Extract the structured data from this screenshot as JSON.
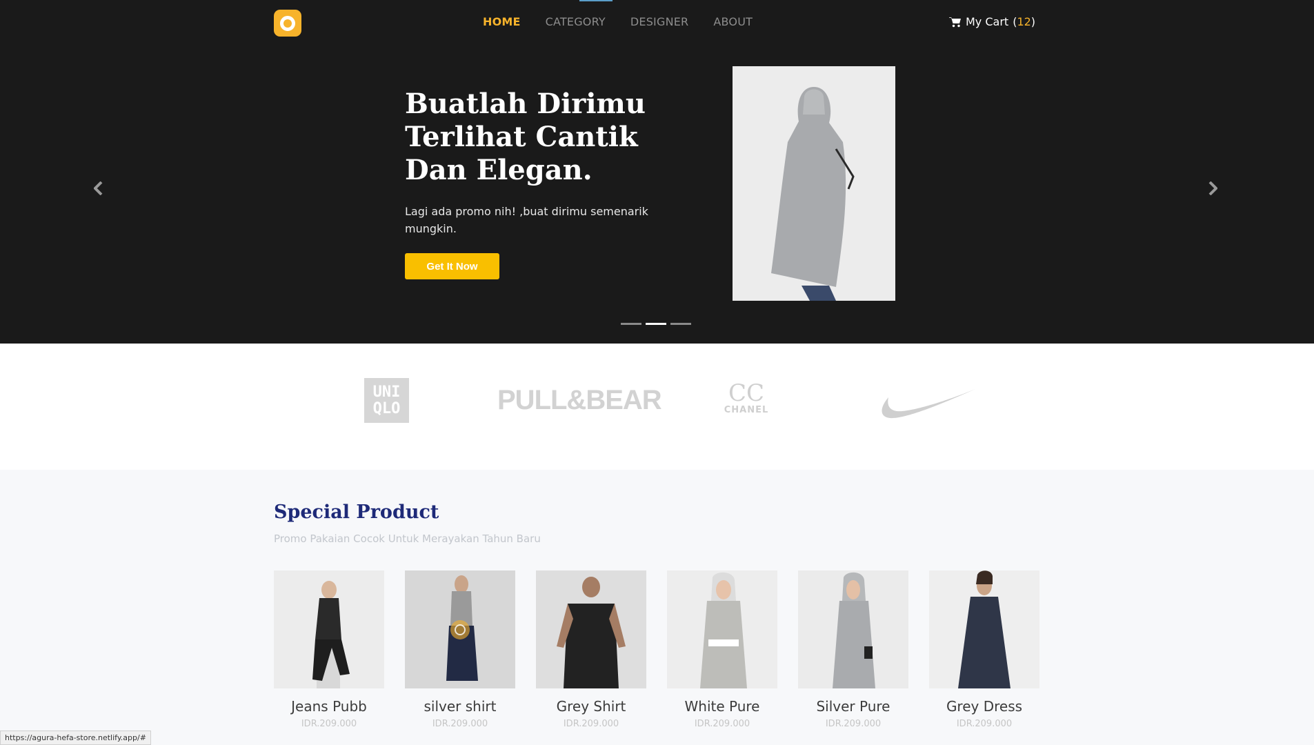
{
  "header": {
    "logo": "store-logo",
    "nav": [
      {
        "label": "HOME",
        "active": true
      },
      {
        "label": "CATEGORY",
        "active": false
      },
      {
        "label": "DESIGNER",
        "active": false
      },
      {
        "label": "ABOUT",
        "active": false
      }
    ],
    "cart": {
      "label": "My Cart",
      "open_paren": "(",
      "count": "12",
      "close_paren": ")",
      "icon": "cart-icon"
    }
  },
  "hero": {
    "title": "Buatlah Dirimu Terlihat Cantik Dan Elegan.",
    "subtitle": "Lagi ada promo nih! ,buat dirimu semenarik mungkin.",
    "cta": "Get It Now",
    "slides": 3,
    "active_slide": 2,
    "prev_icon": "chevron-left-icon",
    "next_icon": "chevron-right-icon"
  },
  "brands": {
    "uniqlo_top": "UNI",
    "uniqlo_bottom": "QLO",
    "pullbear": "PULL&BEAR",
    "chanel_mark": "CC",
    "chanel": "CHANEL",
    "nike": "nike-swoosh"
  },
  "products_section": {
    "title": "Special Product",
    "subtitle": "Promo Pakaian Cocok Untuk Merayakan Tahun Baru",
    "items": [
      {
        "name": "Jeans Pubb",
        "price": "IDR.209.000"
      },
      {
        "name": "silver shirt",
        "price": "IDR.209.000"
      },
      {
        "name": "Grey Shirt",
        "price": "IDR.209.000"
      },
      {
        "name": "White Pure",
        "price": "IDR.209.000"
      },
      {
        "name": "Silver Pure",
        "price": "IDR.209.000"
      },
      {
        "name": "Grey Dress",
        "price": "IDR.209.000"
      }
    ]
  },
  "status_bar": {
    "url": "https://agura-hefa-store.netlify.app/#"
  },
  "colors": {
    "accent": "#f7b32b",
    "hero_bg": "#1a1a1a",
    "title_blue": "#1e2a78",
    "cta": "#f9bf00"
  }
}
